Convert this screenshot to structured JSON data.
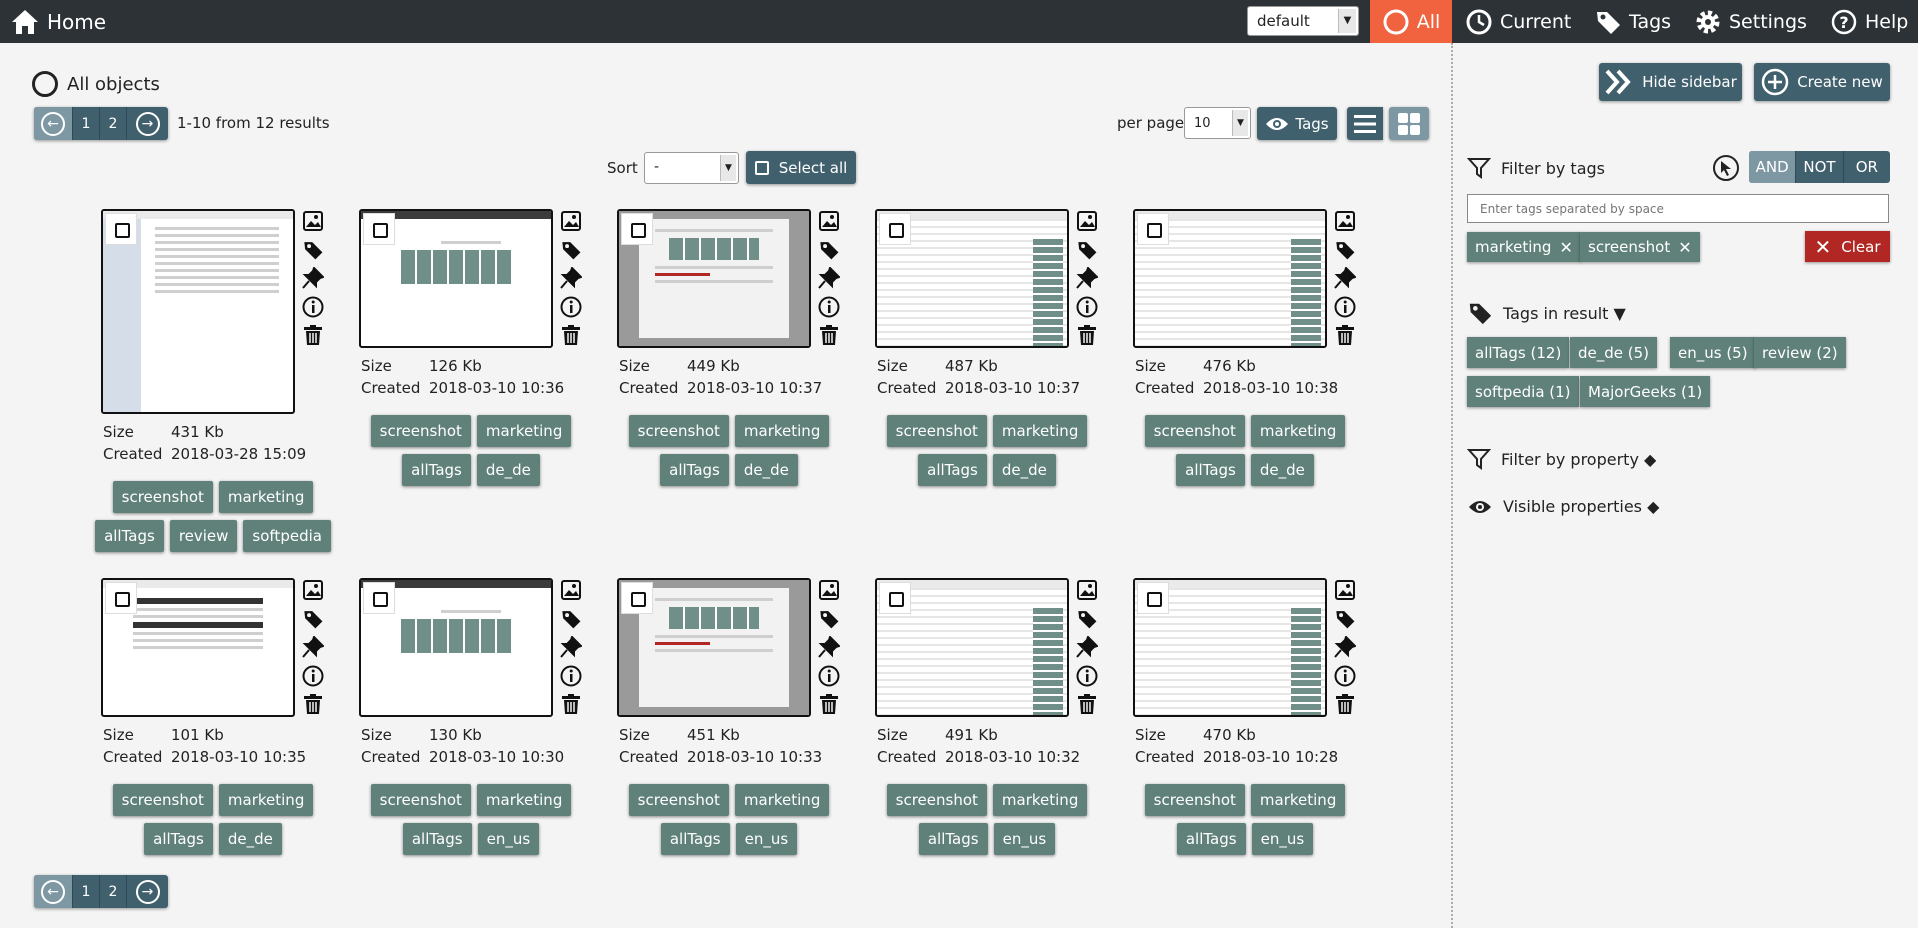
{
  "topbar": {
    "home": "Home",
    "view_select": "default",
    "all": "All",
    "current": "Current",
    "tags": "Tags",
    "settings": "Settings",
    "help": "Help"
  },
  "main": {
    "all_objects": "All objects",
    "pager": {
      "pages": [
        "1",
        "2"
      ]
    },
    "results": "1-10 from 12 results",
    "per_page_label": "per page",
    "per_page_value": "10",
    "tags_toggle": "Tags",
    "sort_label": "Sort",
    "sort_value": "-",
    "select_all": "Select all",
    "size_label": "Size",
    "created_label": "Created",
    "objects": [
      {
        "size": "431 Kb",
        "created": "2018-03-28 15:09",
        "tags1": [
          "screenshot",
          "marketing"
        ],
        "tags2": [
          "allTags",
          "review",
          "softpedia"
        ]
      },
      {
        "size": "126 Kb",
        "created": "2018-03-10 10:36",
        "tags1": [
          "screenshot",
          "marketing"
        ],
        "tags2": [
          "allTags",
          "de_de"
        ]
      },
      {
        "size": "449 Kb",
        "created": "2018-03-10 10:37",
        "tags1": [
          "screenshot",
          "marketing"
        ],
        "tags2": [
          "allTags",
          "de_de"
        ]
      },
      {
        "size": "487 Kb",
        "created": "2018-03-10 10:37",
        "tags1": [
          "screenshot",
          "marketing"
        ],
        "tags2": [
          "allTags",
          "de_de"
        ]
      },
      {
        "size": "476 Kb",
        "created": "2018-03-10 10:38",
        "tags1": [
          "screenshot",
          "marketing"
        ],
        "tags2": [
          "allTags",
          "de_de"
        ]
      },
      {
        "size": "101 Kb",
        "created": "2018-03-10 10:35",
        "tags1": [
          "screenshot",
          "marketing"
        ],
        "tags2": [
          "allTags",
          "de_de"
        ]
      },
      {
        "size": "130 Kb",
        "created": "2018-03-10 10:30",
        "tags1": [
          "screenshot",
          "marketing"
        ],
        "tags2": [
          "allTags",
          "en_us"
        ]
      },
      {
        "size": "451 Kb",
        "created": "2018-03-10 10:33",
        "tags1": [
          "screenshot",
          "marketing"
        ],
        "tags2": [
          "allTags",
          "en_us"
        ]
      },
      {
        "size": "491 Kb",
        "created": "2018-03-10 10:32",
        "tags1": [
          "screenshot",
          "marketing"
        ],
        "tags2": [
          "allTags",
          "en_us"
        ]
      },
      {
        "size": "470 Kb",
        "created": "2018-03-10 10:28",
        "tags1": [
          "screenshot",
          "marketing"
        ],
        "tags2": [
          "allTags",
          "en_us"
        ]
      }
    ]
  },
  "sidebar": {
    "hide_sidebar": "Hide sidebar",
    "create_new": "Create new",
    "filter_by_tags": "Filter by tags",
    "logic": [
      "AND",
      "NOT",
      "OR"
    ],
    "tag_input_placeholder": "Enter tags separated by space",
    "active_filters": [
      "marketing",
      "screenshot"
    ],
    "clear": "Clear",
    "tags_in_result": "Tags in result ▼",
    "result_tags": [
      "allTags (12)",
      "de_de (5)",
      "en_us (5)",
      "review (2)",
      "softpedia (1)",
      "MajorGeeks (1)"
    ],
    "filter_by_property": "Filter by property ◆",
    "visible_properties": "Visible properties ◆"
  },
  "colors": {
    "accent": "#f1623e",
    "button": "#41606e",
    "tag": "#5f8179",
    "clear": "#b02723",
    "topbar": "#2c3236"
  }
}
